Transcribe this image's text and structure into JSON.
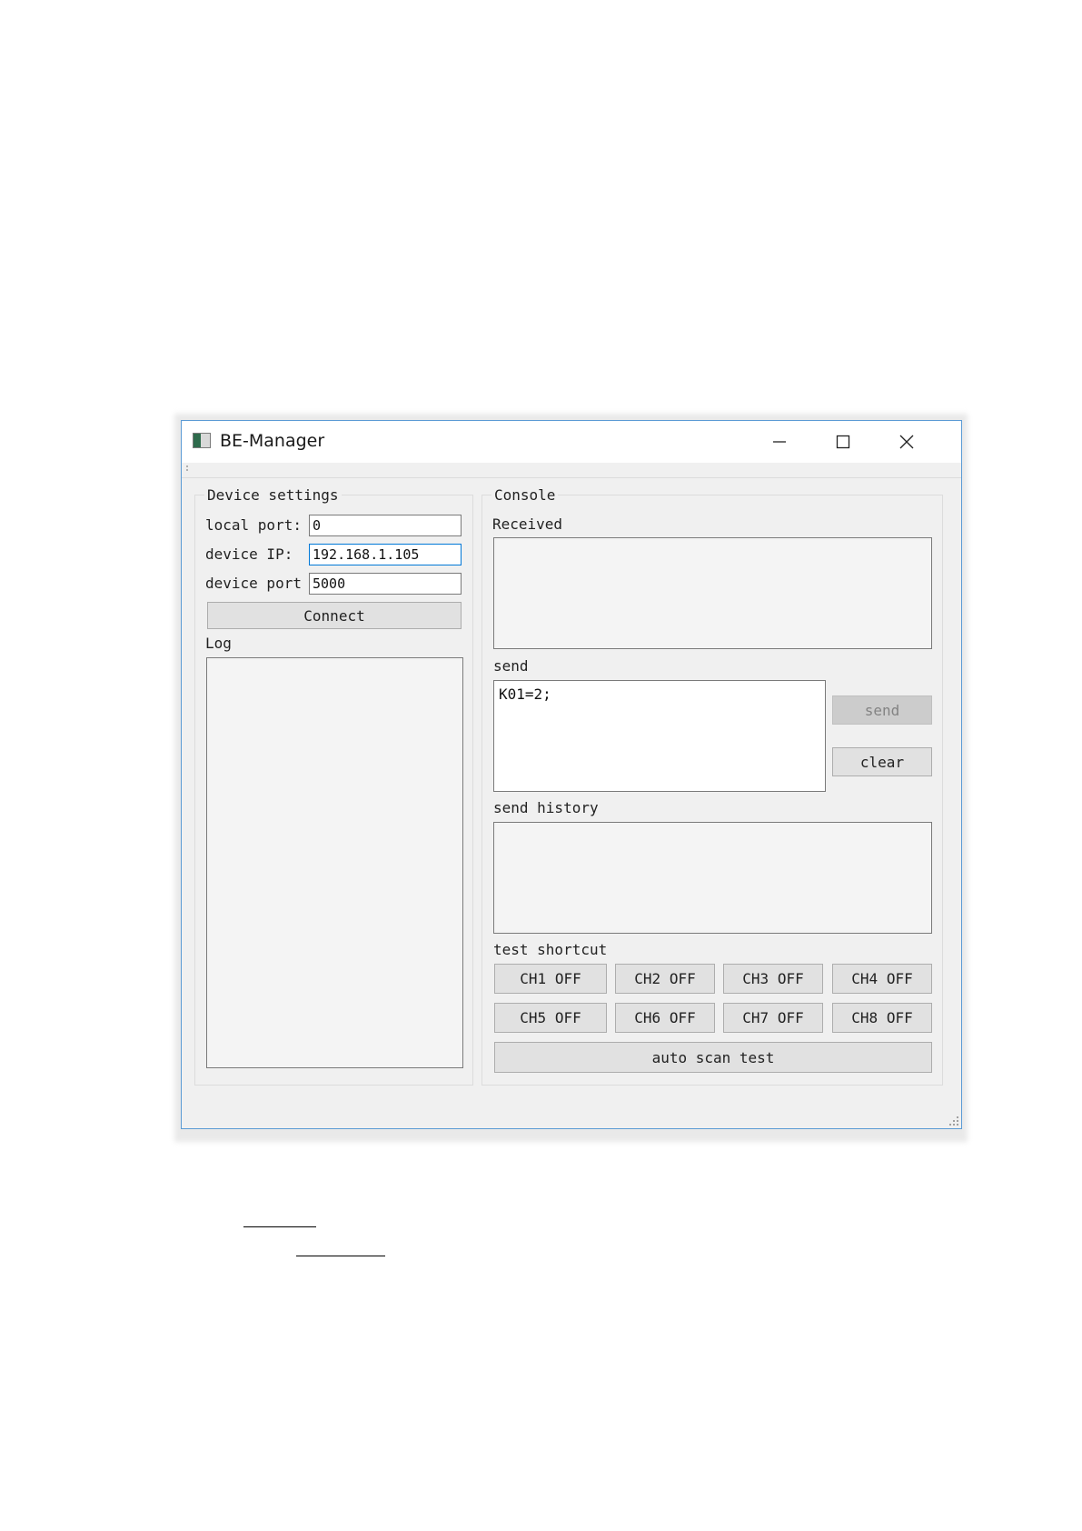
{
  "window": {
    "title": "BE-Manager"
  },
  "device_settings": {
    "group_title": "Device settings",
    "local_port_label": "local port:",
    "local_port_value": "0",
    "device_ip_label": "device IP:",
    "device_ip_value": "192.168.1.105",
    "device_port_label": "device port",
    "device_port_value": "5000",
    "connect_label": "Connect",
    "log_label": "Log"
  },
  "console": {
    "group_title": "Console",
    "received_label": "Received",
    "send_label": "send",
    "send_value": "K01=2;",
    "send_button_label": "send",
    "clear_button_label": "clear",
    "history_label": "send history",
    "shortcut_label": "test shortcut",
    "channels": [
      "CH1 OFF",
      "CH2 OFF",
      "CH3 OFF",
      "CH4 OFF",
      "CH5 OFF",
      "CH6 OFF",
      "CH7 OFF",
      "CH8 OFF"
    ],
    "auto_scan_label": "auto scan test"
  },
  "icons": {
    "app": "app-icon",
    "minimize": "minimize-icon",
    "maximize": "maximize-icon",
    "close": "close-icon",
    "resize": "resize-grip-icon"
  },
  "colors": {
    "window_border": "#5b9bd5",
    "focus_border": "#0078d7",
    "button_face": "#e1e1e1",
    "disabled_text": "#838383"
  }
}
